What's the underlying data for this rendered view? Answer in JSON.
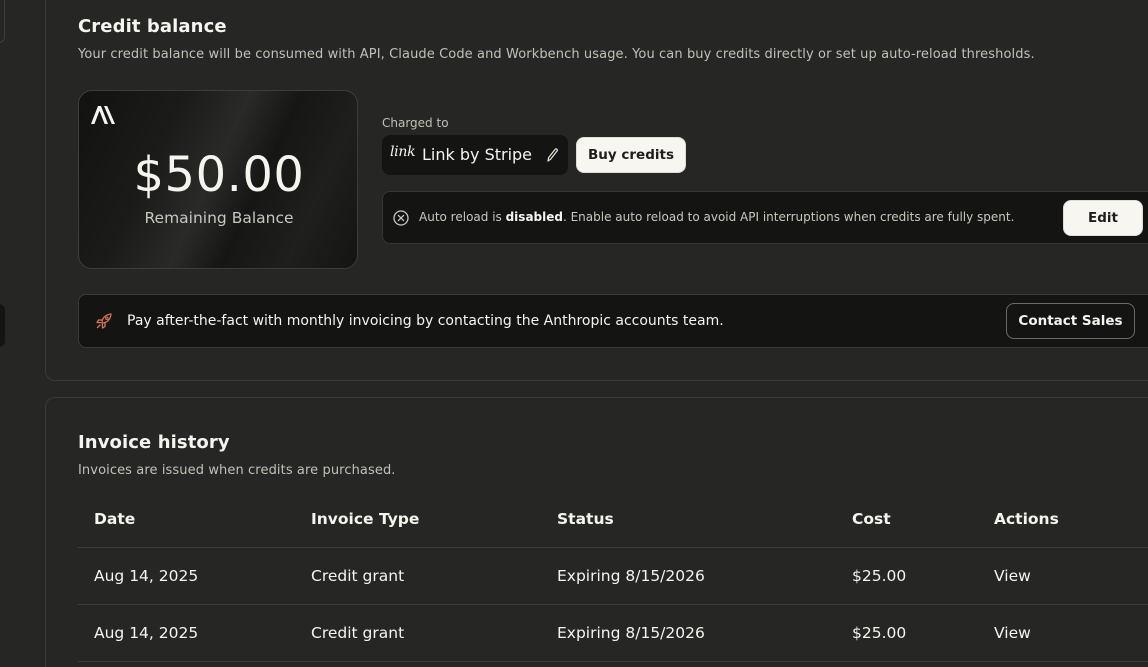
{
  "colors": {
    "background": "#262624",
    "surface": "#141413",
    "text": "#f5f4ee",
    "muted_text": "#c2c0b6",
    "button_light": "#f7f6f1",
    "rocket_accent": "#d97757"
  },
  "credit_balance": {
    "title": "Credit balance",
    "description": "Your credit balance will be consumed with API, Claude Code and Workbench usage. You can buy credits directly or set up auto-reload thresholds.",
    "card": {
      "logo_icon": "anthropic-logo-icon",
      "amount": "$50.00",
      "label": "Remaining Balance"
    },
    "charged_to_label": "Charged to",
    "payment_method": {
      "brand_mark": "link",
      "name": "Link by Stripe",
      "edit_icon": "pencil-icon"
    },
    "buy_button": "Buy credits",
    "auto_reload": {
      "icon": "x-circle-icon",
      "prefix": "Auto reload is ",
      "state": "disabled",
      "suffix": ". Enable auto reload to avoid API interruptions when credits are fully spent.",
      "edit_button": "Edit"
    },
    "invoicing_banner": {
      "icon": "rocket-icon",
      "text": "Pay after-the-fact with monthly invoicing by contacting the Anthropic accounts team.",
      "button": "Contact Sales"
    }
  },
  "invoice_history": {
    "title": "Invoice history",
    "description": "Invoices are issued when credits are purchased.",
    "columns": [
      "Date",
      "Invoice Type",
      "Status",
      "Cost",
      "Actions"
    ],
    "rows": [
      {
        "date": "Aug 14, 2025",
        "type": "Credit grant",
        "status": "Expiring 8/15/2026",
        "cost": "$25.00",
        "action": "View"
      },
      {
        "date": "Aug 14, 2025",
        "type": "Credit grant",
        "status": "Expiring 8/15/2026",
        "cost": "$25.00",
        "action": "View"
      }
    ]
  }
}
